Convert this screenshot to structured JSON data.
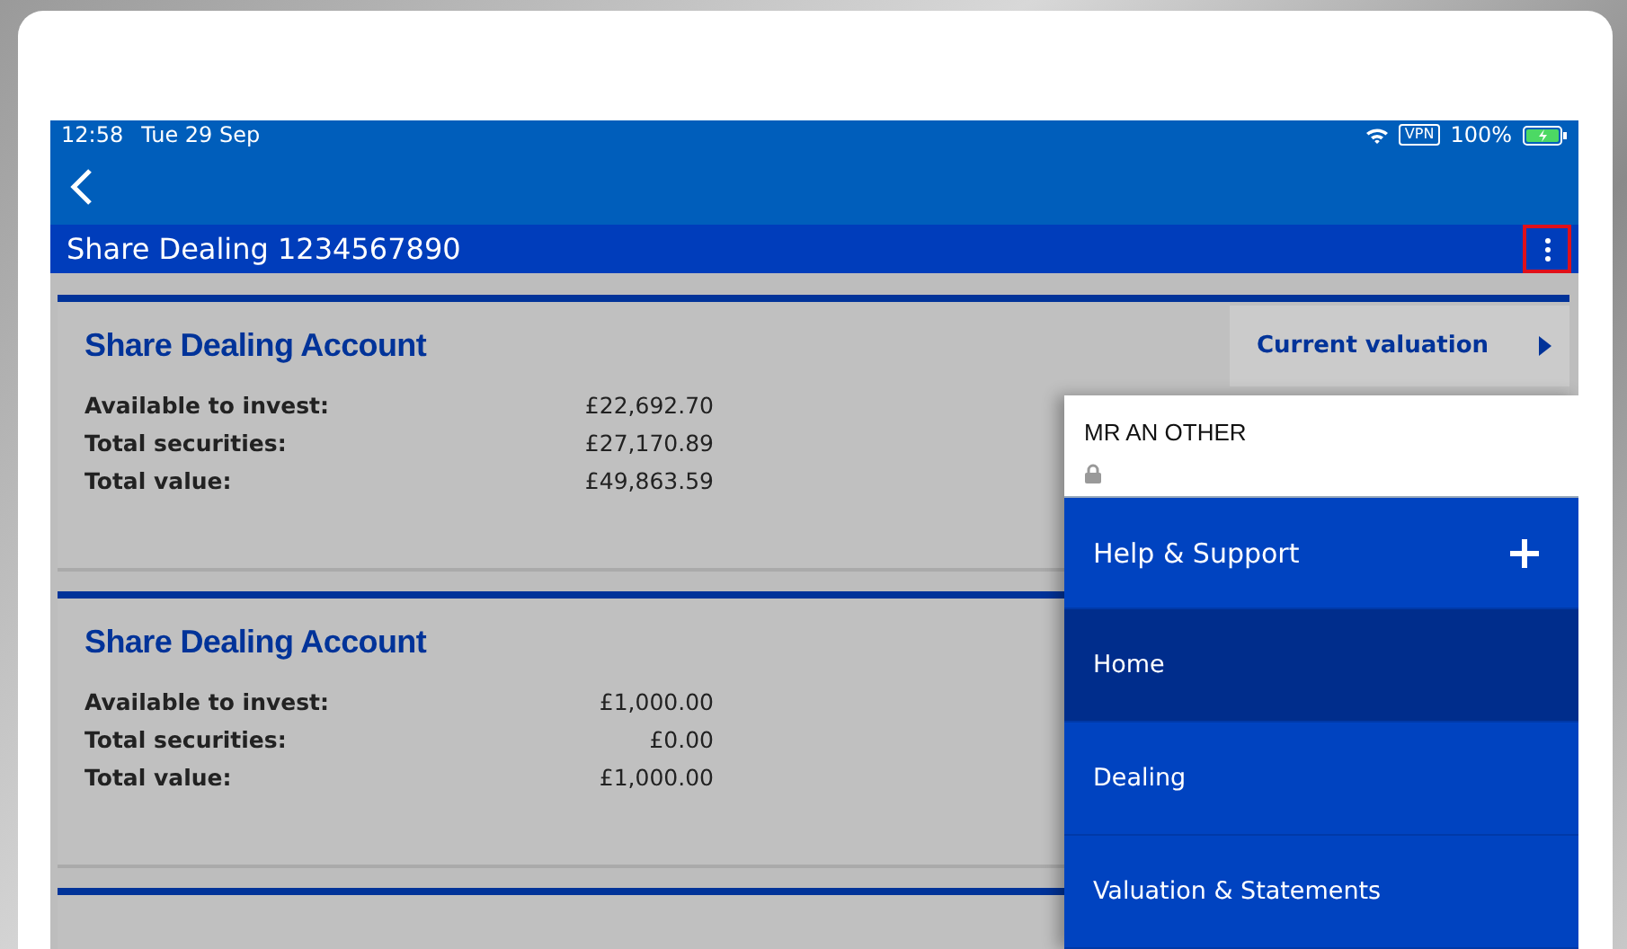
{
  "status_bar": {
    "time": "12:58",
    "date": "Tue 29 Sep",
    "vpn": "VPN",
    "battery": "100%"
  },
  "title_bar": {
    "title": "Share Dealing 1234567890",
    "menu_button": {
      "highlighted": true
    }
  },
  "accounts": [
    {
      "title": "Share Dealing Account",
      "rows": [
        {
          "label": "Available to invest:",
          "value": "£22,692.70"
        },
        {
          "label": "Total securities:",
          "value": "£27,170.89"
        },
        {
          "label": "Total value:",
          "value": "£49,863.59"
        }
      ],
      "link": "Current valuation"
    },
    {
      "title": "Share Dealing Account",
      "rows": [
        {
          "label": "Available to invest:",
          "value": "£1,000.00"
        },
        {
          "label": "Total securities:",
          "value": "£0.00"
        },
        {
          "label": "Total value:",
          "value": "£1,000.00"
        }
      ]
    }
  ],
  "menu": {
    "user": "MR AN OTHER",
    "locked": true,
    "items": [
      {
        "kind": "expandable",
        "label": "Help & Support",
        "expanded": false,
        "selected": false
      },
      {
        "kind": "link",
        "label": "Home",
        "selected": true
      },
      {
        "kind": "link",
        "label": "Dealing",
        "selected": false
      },
      {
        "kind": "link",
        "label": "Valuation & Statements",
        "selected": false
      }
    ]
  }
}
